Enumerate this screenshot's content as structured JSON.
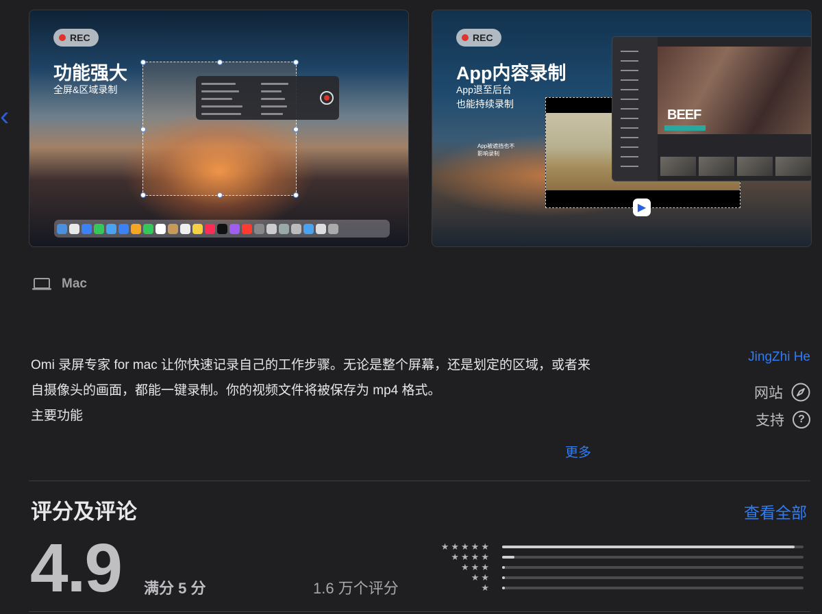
{
  "screenshots": [
    {
      "rec_label": "REC",
      "title": "功能强大",
      "subtitle": "全屏&区域录制"
    },
    {
      "rec_label": "REC",
      "title": "App内容录制",
      "subtitle": "App退至后台也能持续录制",
      "annotation": "App被遮挡也不影响录制",
      "app_title": "BEEF"
    }
  ],
  "platform": {
    "icon": "laptop-icon",
    "label": "Mac"
  },
  "description": {
    "paragraph": "Omi 录屏专家 for mac 让你快速记录自己的工作步骤。无论是整个屏幕，还是划定的区域，或者来自摄像头的画面，都能一键录制。你的视频文件将被保存为 mp4 格式。",
    "heading": "主要功能",
    "more_label": "更多"
  },
  "developer": {
    "name": "JingZhi He",
    "website_label": "网站",
    "support_label": "支持"
  },
  "ratings": {
    "title": "评分及评论",
    "see_all": "查看全部",
    "score": "4.9",
    "out_of": "满分 5 分",
    "count": "1.6 万个评分",
    "distribution": [
      {
        "stars": "★★★★★",
        "fraction": 0.97
      },
      {
        "stars": "★★★★",
        "fraction": 0.04
      },
      {
        "stars": "★★★",
        "fraction": 0.006
      },
      {
        "stars": "★★",
        "fraction": 0.003
      },
      {
        "stars": "★",
        "fraction": 0.003
      }
    ]
  },
  "colors": {
    "accent": "#2f7df6",
    "background": "#1f1f22",
    "rec_dot": "#e0332e"
  }
}
